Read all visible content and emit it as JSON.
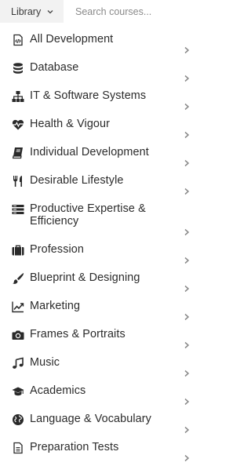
{
  "topbar": {
    "library_label": "Library",
    "search_placeholder": "Search courses..."
  },
  "colors": {
    "icon": "#2a2a2a",
    "arrow": "#8a8a8a",
    "select_bg": "#f2f2f2"
  },
  "menu": {
    "items": [
      {
        "label": "All Development",
        "icon": "code-file-icon"
      },
      {
        "label": "Database",
        "icon": "database-icon"
      },
      {
        "label": "IT & Software Systems",
        "icon": "sitemap-icon"
      },
      {
        "label": "Health & Vigour",
        "icon": "heartbeat-icon"
      },
      {
        "label": "Individual Development",
        "icon": "book-icon"
      },
      {
        "label": "Desirable Lifestyle",
        "icon": "utensils-icon"
      },
      {
        "label": "Productive Expertise & Efficiency",
        "icon": "list-icon"
      },
      {
        "label": "Profession",
        "icon": "briefcase-icon"
      },
      {
        "label": "Blueprint & Designing",
        "icon": "paintbrush-icon"
      },
      {
        "label": "Marketing",
        "icon": "line-chart-icon"
      },
      {
        "label": "Frames & Portraits",
        "icon": "camera-icon"
      },
      {
        "label": "Music",
        "icon": "music-icon"
      },
      {
        "label": "Academics",
        "icon": "graduation-cap-icon"
      },
      {
        "label": "Language & Vocabulary",
        "icon": "globe-icon"
      },
      {
        "label": "Preparation Tests",
        "icon": "document-icon"
      }
    ]
  }
}
